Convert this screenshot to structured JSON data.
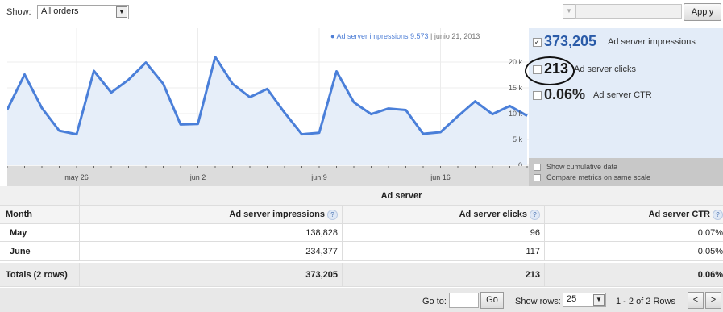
{
  "toolbar": {
    "show_label": "Show:",
    "filter_value": "All orders",
    "apply_label": "Apply"
  },
  "chart_data": {
    "type": "area",
    "tooltip": {
      "series": "Ad server impressions",
      "value": "9.573",
      "date": "junio 21, 2013"
    },
    "y_ticks": [
      "0",
      "5 k",
      "10 k",
      "15 k",
      "20 k"
    ],
    "ylim": [
      0,
      25000
    ],
    "x_tick_labels": [
      {
        "label": "may 26",
        "day": 4
      },
      {
        "label": "jun 2",
        "day": 11
      },
      {
        "label": "jun 9",
        "day": 18
      },
      {
        "label": "jun 16",
        "day": 25
      }
    ],
    "x": [
      "may 22",
      "may 23",
      "may 24",
      "may 25",
      "may 26",
      "may 27",
      "may 28",
      "may 29",
      "may 30",
      "may 31",
      "jun 1",
      "jun 2",
      "jun 3",
      "jun 4",
      "jun 5",
      "jun 6",
      "jun 7",
      "jun 8",
      "jun 9",
      "jun 10",
      "jun 11",
      "jun 12",
      "jun 13",
      "jun 14",
      "jun 15",
      "jun 16",
      "jun 17",
      "jun 18",
      "jun 19",
      "jun 20",
      "jun 21"
    ],
    "series": [
      {
        "name": "Ad server impressions",
        "values": [
          10800,
          17600,
          11100,
          6700,
          6000,
          18300,
          14100,
          16600,
          19900,
          15800,
          7900,
          8000,
          21000,
          15800,
          13200,
          14800,
          10200,
          6000,
          6300,
          18200,
          12200,
          9900,
          11000,
          10700,
          6100,
          6400,
          9500,
          12400,
          9900,
          11500,
          9573
        ]
      }
    ],
    "color": "#4a7fd9",
    "fill": "#e6eef9",
    "grid": true
  },
  "metrics": [
    {
      "value": "373,205",
      "label": "Ad server impressions",
      "checked": true
    },
    {
      "value": "213",
      "label": "Ad server clicks",
      "checked": false
    },
    {
      "value": "0.06%",
      "label": "Ad server CTR",
      "checked": false
    }
  ],
  "options": {
    "cumulative": "Show cumulative data",
    "same_scale": "Compare metrics on same scale"
  },
  "table": {
    "group_header": "Ad server",
    "columns": [
      "Month",
      "Ad server impressions",
      "Ad server clicks",
      "Ad server CTR"
    ],
    "rows": [
      {
        "month": "May",
        "impressions": "138,828",
        "clicks": "96",
        "ctr": "0.07%"
      },
      {
        "month": "June",
        "impressions": "234,377",
        "clicks": "117",
        "ctr": "0.05%"
      }
    ],
    "totals": {
      "label": "Totals (2 rows)",
      "impressions": "373,205",
      "clicks": "213",
      "ctr": "0.06%"
    }
  },
  "footer": {
    "goto_label": "Go to:",
    "go_label": "Go",
    "show_rows_label": "Show rows:",
    "rows_value": "25",
    "range_text": "1 - 2 of 2 Rows",
    "prev": "<",
    "next": ">"
  }
}
